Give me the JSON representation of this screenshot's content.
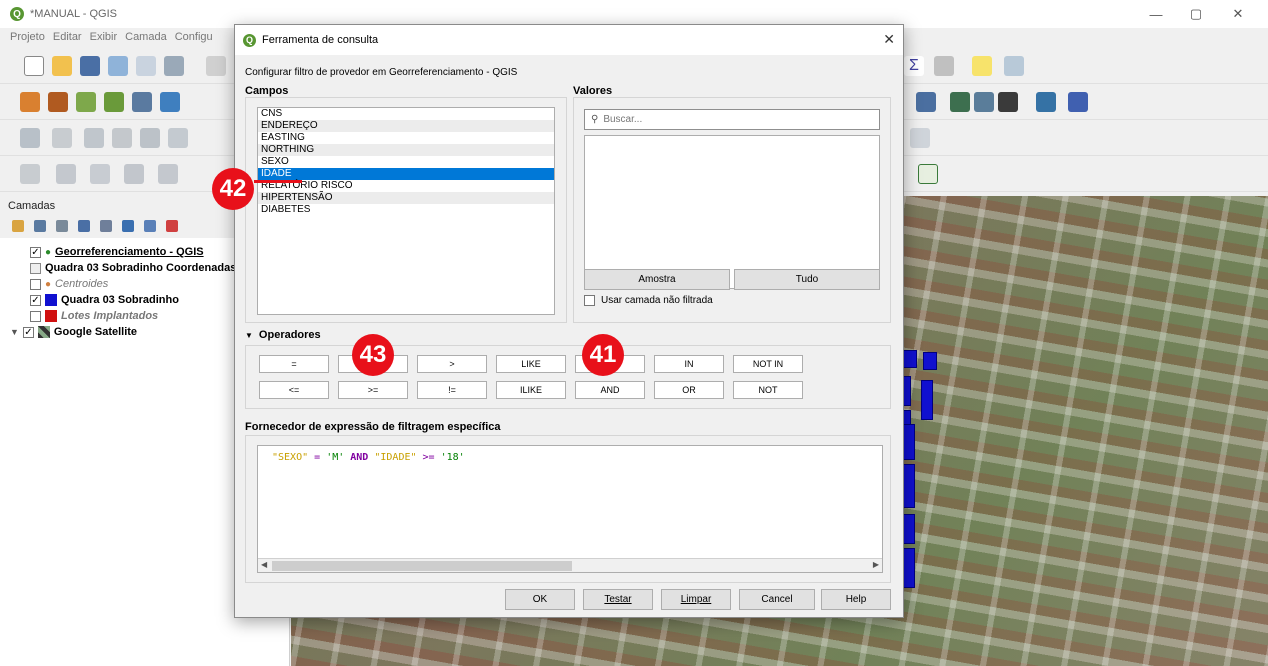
{
  "window": {
    "title": "*MANUAL - QGIS",
    "min": "—",
    "max": "▢",
    "close": "✕"
  },
  "menu": [
    "Projeto",
    "Editar",
    "Exibir",
    "Camada",
    "Configu"
  ],
  "layers_panel": {
    "title": "Camadas",
    "layers": [
      {
        "name": "Georreferenciamento - QGIS",
        "checked": true,
        "style": "point-green"
      },
      {
        "name": "Quadra 03 Sobradinho Coordenadas",
        "checked": null,
        "style": "table"
      },
      {
        "name": "Centroides",
        "checked": false,
        "style": "point-orange"
      },
      {
        "name": "Quadra 03 Sobradinho",
        "checked": true,
        "style": "polygon-blue"
      },
      {
        "name": "Lotes Implantados",
        "checked": false,
        "style": "polygon-red"
      },
      {
        "name": "Google Satellite",
        "checked": true,
        "style": "raster"
      }
    ]
  },
  "dialog": {
    "title": "Ferramenta de consulta",
    "close": "✕",
    "subtitle": "Configurar filtro de provedor em Georreferenciamento - QGIS",
    "fields_label": "Campos",
    "fields": [
      "CNS",
      "ENDEREÇO",
      "EASTING",
      "NORTHING",
      "SEXO",
      "IDADE",
      "RELATÓRIO RISCO",
      "HIPERTENSÃO",
      "DIABETES"
    ],
    "selected_field": "IDADE",
    "values_label": "Valores",
    "search_placeholder": "Buscar...",
    "sample_button": "Amostra",
    "all_button": "Tudo",
    "use_unfiltered_label": "Usar camada não filtrada",
    "operators_label": "Operadores",
    "operators_row1": [
      "=",
      "<",
      ">",
      "LIKE",
      "%",
      "IN",
      "NOT IN"
    ],
    "operators_row2": [
      "<=",
      ">=",
      "!=",
      "ILIKE",
      "AND",
      "OR",
      "NOT"
    ],
    "expression_label": "Fornecedor de expressão de filtragem específica",
    "expression": {
      "f1": "\"SEXO\"",
      "op1": " = ",
      "v1": "'M'",
      "and": " AND ",
      "f2": "\"IDADE\"",
      "op2": " >= ",
      "v2": "'18'"
    },
    "buttons": {
      "ok": "OK",
      "test": "Testar",
      "clear": "Limpar",
      "cancel": "Cancel",
      "help": "Help"
    }
  },
  "annotations": [
    "42",
    "43",
    "41"
  ],
  "colors": {
    "selection": "#0078d7",
    "badge": "#e8101a",
    "field_name": "#c8a000",
    "keyword": "#8000a0",
    "literal": "#008000"
  }
}
